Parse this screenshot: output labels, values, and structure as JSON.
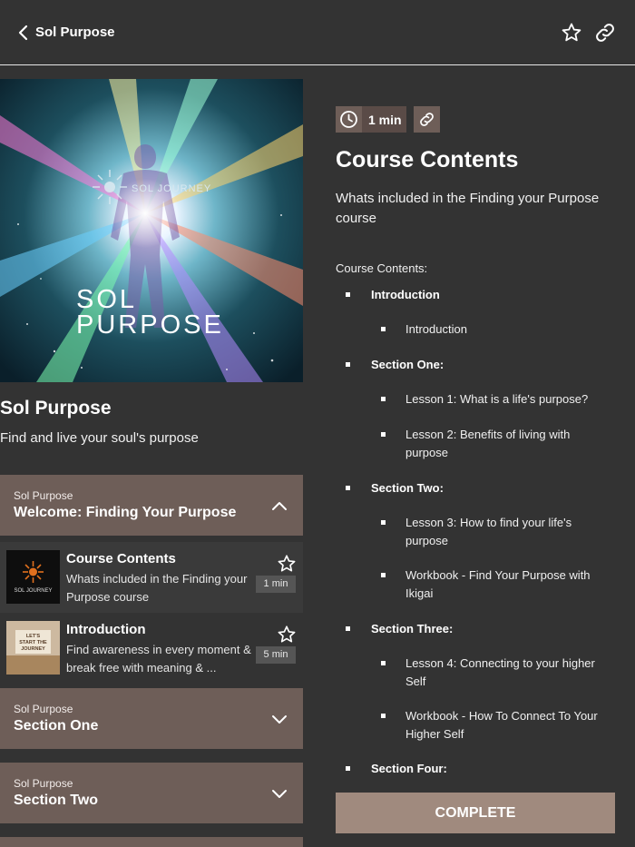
{
  "header": {
    "title": "Sol Purpose",
    "back_icon": "chevron-left-icon",
    "favorite_icon": "star-outline-icon",
    "share_icon": "link-icon"
  },
  "course": {
    "hero_logo_text": "SOL JOURNEY",
    "hero_title_line1": "SOL",
    "hero_title_line2": "PURPOSE",
    "title": "Sol Purpose",
    "subtitle": "Find and live your soul's purpose"
  },
  "sections": [
    {
      "kicker": "Sol Purpose",
      "name": "Welcome: Finding Your Purpose",
      "expanded": true,
      "lessons": [
        {
          "title": "Course Contents",
          "description": "Whats included in the Finding your Purpose course",
          "duration": "1 min",
          "thumb_text": "SOL JOURNEY"
        },
        {
          "title": "Introduction",
          "description": "Find awareness in every moment & break free with meaning & ...",
          "duration": "5 min",
          "thumb_text": "LET'S START THE JOURNEY"
        }
      ]
    },
    {
      "kicker": "Sol Purpose",
      "name": "Section One",
      "expanded": false
    },
    {
      "kicker": "Sol Purpose",
      "name": "Section Two",
      "expanded": false
    }
  ],
  "detail": {
    "duration": "1 min",
    "title": "Course Contents",
    "description": "Whats included in the Finding your Purpose course",
    "contents_label": "Course Contents:",
    "contents": [
      {
        "level": 1,
        "text": "Introduction"
      },
      {
        "level": 2,
        "text": "Introduction"
      },
      {
        "level": 1,
        "text": "Section One:"
      },
      {
        "level": 2,
        "text": "Lesson 1: What is a life's purpose?"
      },
      {
        "level": 2,
        "text": "Lesson 2: Benefits of living with purpose"
      },
      {
        "level": 1,
        "text": "Section Two:"
      },
      {
        "level": 2,
        "text": "Lesson 3: How to find your life's purpose"
      },
      {
        "level": 2,
        "text": "Workbook - Find Your Purpose with Ikigai"
      },
      {
        "level": 1,
        "text": "Section Three:"
      },
      {
        "level": 2,
        "text": "Lesson 4: Connecting to your higher Self"
      },
      {
        "level": 2,
        "text": "Workbook - How To Connect To Your Higher Self"
      },
      {
        "level": 1,
        "text": "Section Four:"
      }
    ],
    "complete_label": "COMPLETE"
  },
  "colors": {
    "background": "#333333",
    "section_header": "#6e5e58",
    "complete_button": "#a08a7e"
  }
}
